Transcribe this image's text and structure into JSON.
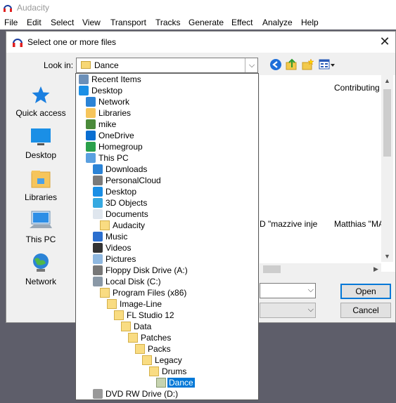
{
  "app": {
    "title": "Audacity",
    "menu": [
      "File",
      "Edit",
      "Select",
      "View",
      "Transport",
      "Tracks",
      "Generate",
      "Effect",
      "Analyze",
      "Help"
    ]
  },
  "dialog": {
    "title": "Select one or more files",
    "close_glyph": "✕",
    "look_in_label": "Look in:",
    "look_in_value": "Dance",
    "combo_arrow": "⌵",
    "toolbar": {
      "back": "back-icon",
      "up": "up-folder-icon",
      "new": "new-folder-icon",
      "view": "view-menu-icon"
    },
    "places": [
      {
        "label": "Quick access",
        "icon": "star-icon"
      },
      {
        "label": "Desktop",
        "icon": "desktop-icon"
      },
      {
        "label": "Libraries",
        "icon": "libraries-icon"
      },
      {
        "label": "This PC",
        "icon": "computer-icon"
      },
      {
        "label": "Network",
        "icon": "network-icon"
      }
    ],
    "file_list": {
      "column_header": "Contributing",
      "row_fragment_1": "D \"mazzive inje",
      "row_fragment_2": "Matthias \"MA"
    },
    "open_label": "Open",
    "cancel_label": "Cancel"
  },
  "dropdown": {
    "items": [
      {
        "label": "Recent Items",
        "icon": "recent-items-icon"
      },
      {
        "label": "Desktop",
        "icon": "desktop-icon"
      },
      {
        "label": "Network",
        "icon": "network-icon"
      },
      {
        "label": "Libraries",
        "icon": "libraries-icon"
      },
      {
        "label": "mike",
        "icon": "user-icon"
      },
      {
        "label": "OneDrive",
        "icon": "onedrive-icon"
      },
      {
        "label": "Homegroup",
        "icon": "homegroup-icon"
      },
      {
        "label": "This PC",
        "icon": "computer-icon"
      },
      {
        "label": "Downloads",
        "icon": "downloads-icon"
      },
      {
        "label": "PersonalCloud",
        "icon": "cloud-drive-icon"
      },
      {
        "label": "Desktop",
        "icon": "desktop-icon"
      },
      {
        "label": "3D Objects",
        "icon": "3d-objects-icon"
      },
      {
        "label": "Documents",
        "icon": "documents-icon"
      },
      {
        "label": "Audacity",
        "icon": "folder-icon"
      },
      {
        "label": "Music",
        "icon": "music-icon"
      },
      {
        "label": "Videos",
        "icon": "videos-icon"
      },
      {
        "label": "Pictures",
        "icon": "pictures-icon"
      },
      {
        "label": "Floppy Disk Drive (A:)",
        "icon": "floppy-drive-icon"
      },
      {
        "label": "Local Disk (C:)",
        "icon": "hard-drive-icon"
      },
      {
        "label": "Program Files (x86)",
        "icon": "folder-icon"
      },
      {
        "label": "Image-Line",
        "icon": "folder-icon"
      },
      {
        "label": "FL Studio 12",
        "icon": "folder-icon"
      },
      {
        "label": "Data",
        "icon": "folder-icon"
      },
      {
        "label": "Patches",
        "icon": "folder-icon"
      },
      {
        "label": "Packs",
        "icon": "folder-icon"
      },
      {
        "label": "Legacy",
        "icon": "folder-icon"
      },
      {
        "label": "Drums",
        "icon": "folder-icon"
      },
      {
        "label": "Dance",
        "icon": "folder-icon",
        "selected": true
      },
      {
        "label": "DVD RW Drive (D:)",
        "icon": "dvd-drive-icon"
      }
    ]
  },
  "colors": {
    "selection": "#0078d7",
    "folder": "#f9dc82",
    "accent_blue": "#1e90ff"
  }
}
